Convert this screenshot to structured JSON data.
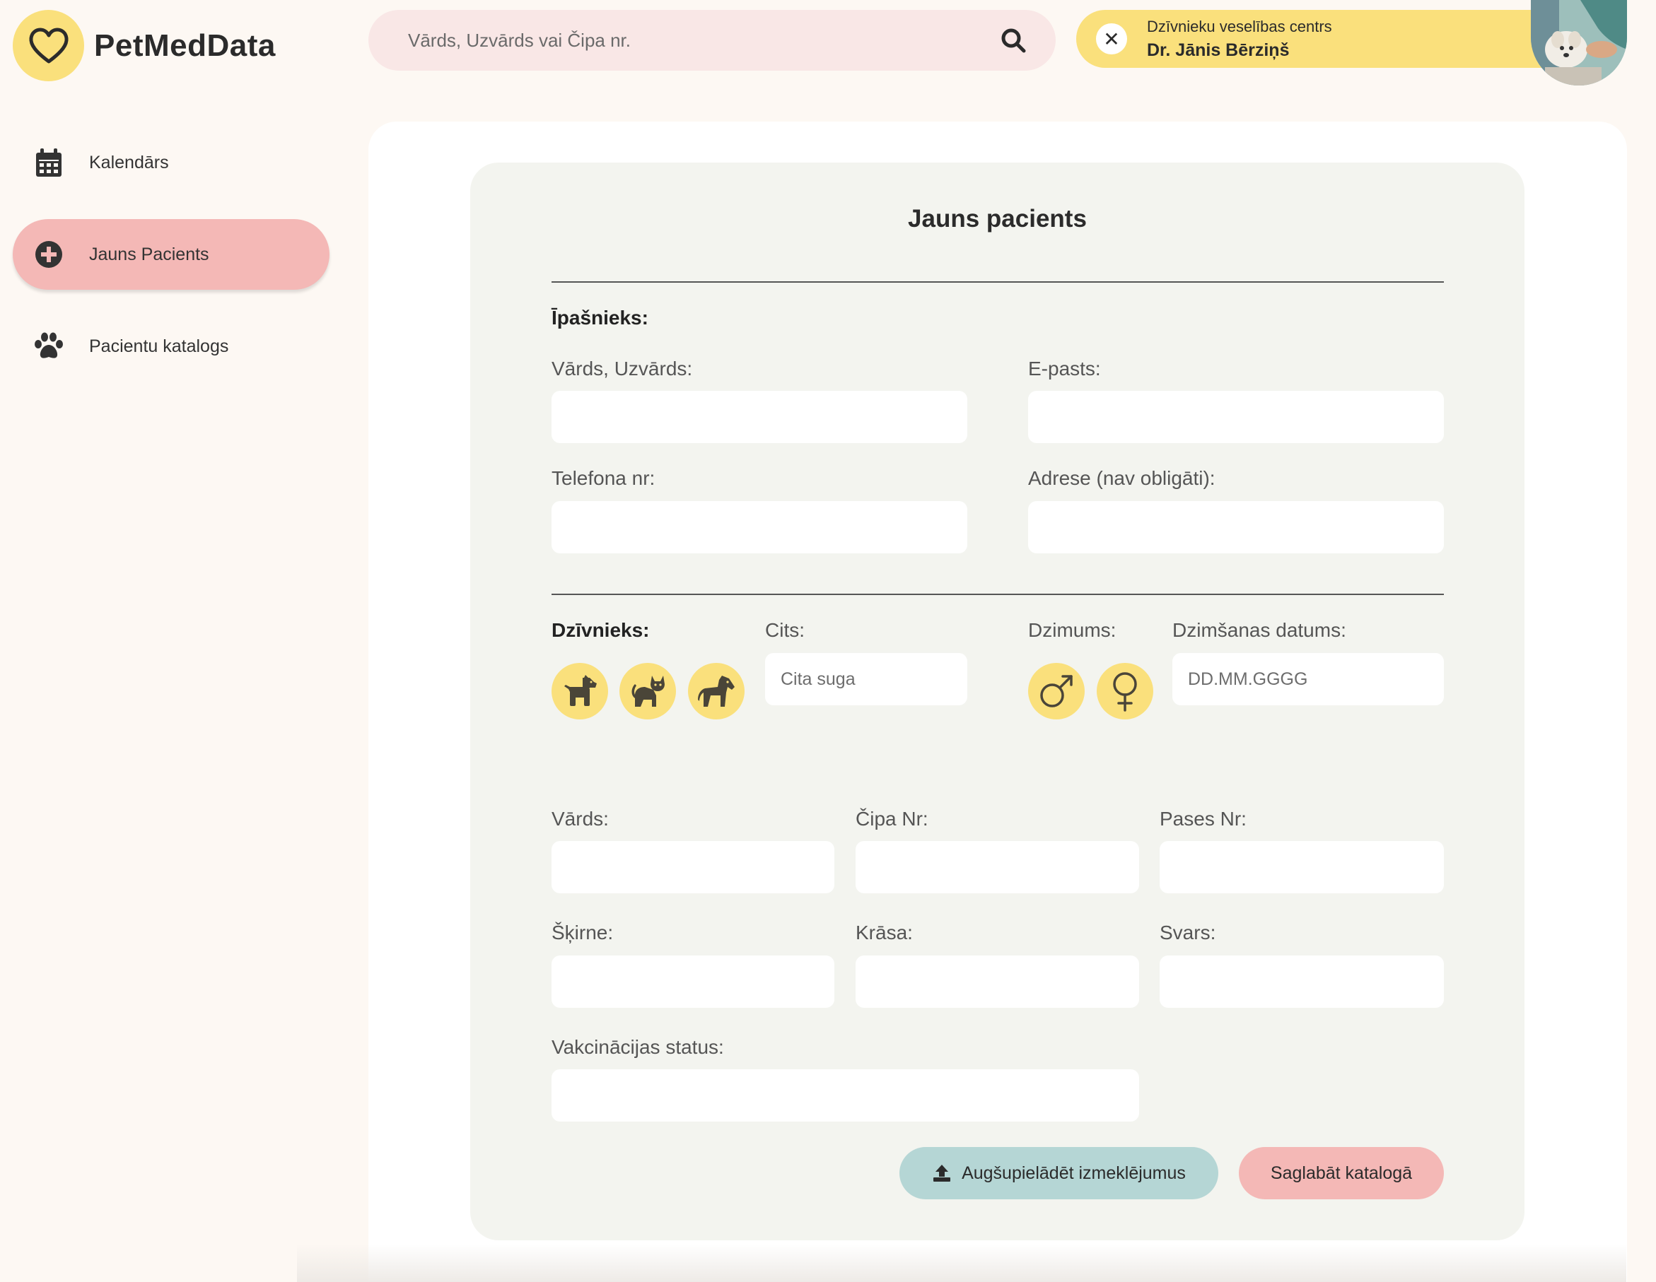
{
  "app": {
    "name": "PetMedData"
  },
  "search": {
    "placeholder": "Vārds, Uzvārds vai Čipa nr."
  },
  "user": {
    "organization": "Dzīvnieku veselības centrs",
    "name": "Dr. Jānis Bērziņš"
  },
  "sidebar": {
    "items": [
      {
        "label": "Kalendārs",
        "icon": "calendar-icon",
        "active": false
      },
      {
        "label": "Jauns Pacients",
        "icon": "plus-circle-icon",
        "active": true
      },
      {
        "label": "Pacientu katalogs",
        "icon": "paw-icon",
        "active": false
      }
    ]
  },
  "form": {
    "title": "Jauns pacients",
    "owner": {
      "section_label": "Īpašnieks:",
      "name_label": "Vārds, Uzvārds:",
      "email_label": "E-pasts:",
      "phone_label": "Telefona nr:",
      "address_label": "Adrese (nav obligāti):"
    },
    "animal": {
      "section_label": "Dzīvnieks:",
      "species_icons": [
        "dog-icon",
        "cat-icon",
        "horse-icon"
      ],
      "other_label": "Cits:",
      "other_placeholder": "Cita suga",
      "sex_label": "Dzimums:",
      "sex_icons": [
        "male-icon",
        "female-icon"
      ],
      "birthdate_label": "Dzimšanas datums:",
      "birthdate_placeholder": "DD.MM.GGGG",
      "name_label": "Vārds:",
      "chip_label": "Čipa Nr:",
      "passport_label": "Pases Nr:",
      "breed_label": "Šķirne:",
      "color_label": "Krāsa:",
      "weight_label": "Svars:",
      "vaccination_label": "Vakcinācijas status:"
    },
    "buttons": {
      "upload_label": "Augšupielādēt izmeklējumus",
      "save_label": "Saglabāt katalogā"
    }
  },
  "colors": {
    "accent_yellow": "#fae07c",
    "accent_pink": "#f4b8b6",
    "accent_teal": "#b5d6d5",
    "background": "#fdf8f3"
  }
}
